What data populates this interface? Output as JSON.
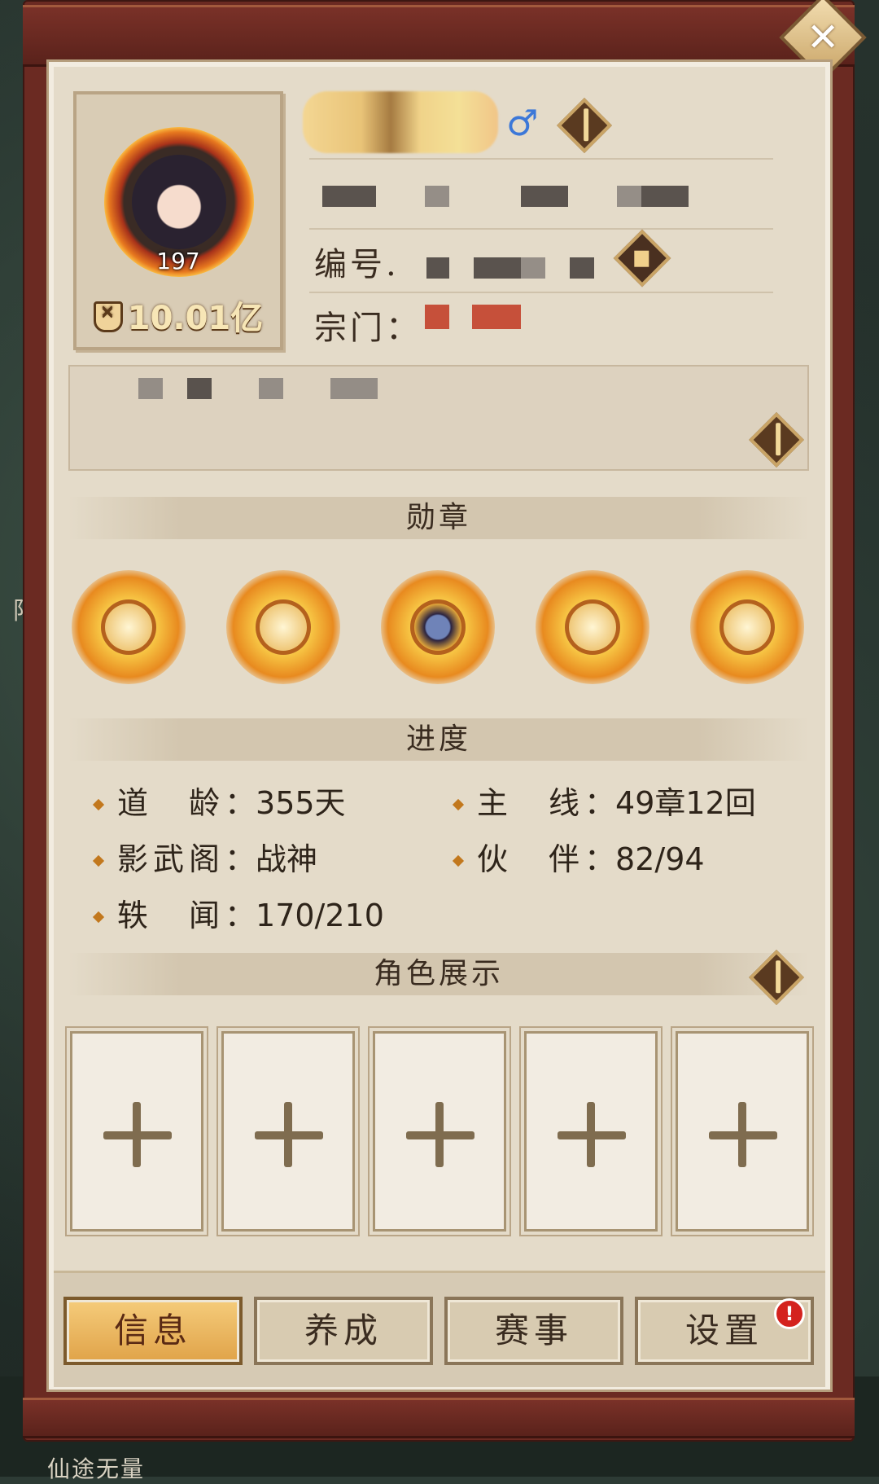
{
  "profile": {
    "level": "197",
    "power": "10.01亿",
    "gender_symbol": "♂",
    "id_label": "编号",
    "sect_label": "宗门"
  },
  "sections": {
    "medals": "勋章",
    "progress": "进度",
    "role_display": "角色展示"
  },
  "medals": [
    {
      "icon": "fan-medal-icon"
    },
    {
      "icon": "pavilion-medal-icon"
    },
    {
      "icon": "cultivator-medal-icon"
    },
    {
      "icon": "deity-medal-icon"
    },
    {
      "icon": "pagoda-medal-icon"
    }
  ],
  "stats": {
    "dao_age": {
      "label": "道　龄",
      "value": "355天"
    },
    "main_line": {
      "label": "主　线",
      "value": "49章12回"
    },
    "shadow_pavilion": {
      "label": "影武阁",
      "value": "战神"
    },
    "partners": {
      "label": "伙　伴",
      "value": "82/94"
    },
    "anecdotes": {
      "label": "轶　闻",
      "value": "170/210"
    }
  },
  "role_slots": [
    "+",
    "+",
    "+",
    "+",
    "+"
  ],
  "tabs": {
    "info": "信息",
    "cultivate": "养成",
    "events": "赛事",
    "settings": "设置",
    "settings_badge": "!"
  },
  "background": {
    "caption": "仙途无量",
    "side_char": "阳"
  },
  "colors": {
    "frame": "#6b2a22",
    "panel": "#e4dbc9",
    "active_tab": "#f5cc7b",
    "gold_accent": "#c9a466",
    "alert_red": "#d4221e"
  }
}
